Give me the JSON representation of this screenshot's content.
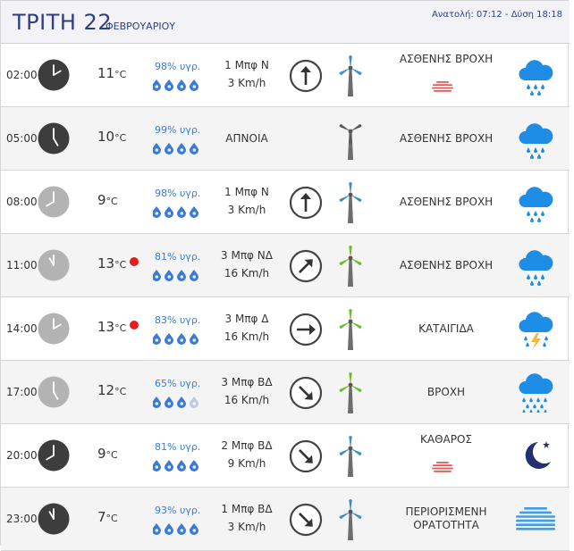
{
  "header": {
    "day": "ΤΡΙΤΗ 22",
    "month": "ΦΕΒΡΟΥΑΡΙΟΥ",
    "sun": "Ανατολή: 07:12 - Δύση 18:18"
  },
  "rows": [
    {
      "time": "02:00",
      "clock": "dark",
      "hour": 2,
      "temp": "11",
      "unit": "°C",
      "hot": false,
      "humidity": "98% υγρ.",
      "drops": 4,
      "wind_force": "1 Μπφ Ν",
      "wind_speed": "3 Km/h",
      "direction": "N",
      "turbine": "blue",
      "condition": "ΑΣΘΕΝΗΣ ΒΡΟΧΗ",
      "fog": true,
      "icon": "rain-cloud-icon",
      "shade": false
    },
    {
      "time": "05:00",
      "clock": "dark",
      "hour": 5,
      "temp": "10",
      "unit": "°C",
      "hot": false,
      "humidity": "99% υγρ.",
      "drops": 4,
      "wind_force": "ΑΠΝΟΙΑ",
      "wind_speed": "",
      "direction": "none",
      "turbine": "gray",
      "condition": "ΑΣΘΕΝΗΣ ΒΡΟΧΗ",
      "fog": false,
      "icon": "rain-cloud-icon",
      "shade": true
    },
    {
      "time": "08:00",
      "clock": "light",
      "hour": 8,
      "temp": "9",
      "unit": "°C",
      "hot": false,
      "humidity": "98% υγρ.",
      "drops": 4,
      "wind_force": "1 Μπφ Ν",
      "wind_speed": "3 Km/h",
      "direction": "N",
      "turbine": "blue",
      "condition": "ΑΣΘΕΝΗΣ ΒΡΟΧΗ",
      "fog": false,
      "icon": "rain-cloud-icon",
      "shade": false
    },
    {
      "time": "11:00",
      "clock": "light",
      "hour": 11,
      "temp": "13",
      "unit": "°C",
      "hot": true,
      "humidity": "81% υγρ.",
      "drops": 4,
      "wind_force": "3 Μπφ ΝΔ",
      "wind_speed": "16 Km/h",
      "direction": "SW",
      "turbine": "green",
      "condition": "ΑΣΘΕΝΗΣ ΒΡΟΧΗ",
      "fog": false,
      "icon": "rain-cloud-icon",
      "shade": true
    },
    {
      "time": "14:00",
      "clock": "light",
      "hour": 2,
      "temp": "13",
      "unit": "°C",
      "hot": true,
      "humidity": "83% υγρ.",
      "drops": 4,
      "wind_force": "3 Μπφ Δ",
      "wind_speed": "16 Km/h",
      "direction": "W",
      "turbine": "green",
      "condition": "ΚΑΤΑΙΓΙΔΑ",
      "fog": false,
      "icon": "thunderstorm-icon",
      "shade": false
    },
    {
      "time": "17:00",
      "clock": "light",
      "hour": 5,
      "temp": "12",
      "unit": "°C",
      "hot": false,
      "humidity": "65% υγρ.",
      "drops": 3,
      "wind_force": "3 Μπφ ΒΔ",
      "wind_speed": "16 Km/h",
      "direction": "NW",
      "turbine": "green",
      "condition": "ΒΡΟΧΗ",
      "fog": false,
      "icon": "heavy-rain-icon",
      "shade": true
    },
    {
      "time": "20:00",
      "clock": "dark",
      "hour": 8,
      "temp": "9",
      "unit": "°C",
      "hot": false,
      "humidity": "81% υγρ.",
      "drops": 4,
      "wind_force": "2 Μπφ ΒΔ",
      "wind_speed": "9 Km/h",
      "direction": "NW",
      "turbine": "blue",
      "condition": "ΚΑΘΑΡΟΣ",
      "fog": true,
      "icon": "moon-icon",
      "shade": false
    },
    {
      "time": "23:00",
      "clock": "dark",
      "hour": 11,
      "temp": "7",
      "unit": "°C",
      "hot": false,
      "humidity": "93% υγρ.",
      "drops": 4,
      "wind_force": "1 Μπφ ΒΔ",
      "wind_speed": "3 Km/h",
      "direction": "NW",
      "turbine": "blue",
      "condition": "ΠΕΡΙΟΡΙΣΜΕΝΗ ΟΡΑΤΟΤΗΤΑ",
      "fog": false,
      "icon": "fog-icon",
      "shade": true
    }
  ],
  "colors": {
    "accent": "#2c3f82",
    "humidity": "#3a7bd5",
    "icon_blue": "#1e8de6",
    "hot_dot": "#e81e1e",
    "fog_red": "#e05a5a",
    "moon": "#232f6e",
    "bolt": "#f6b73c"
  }
}
